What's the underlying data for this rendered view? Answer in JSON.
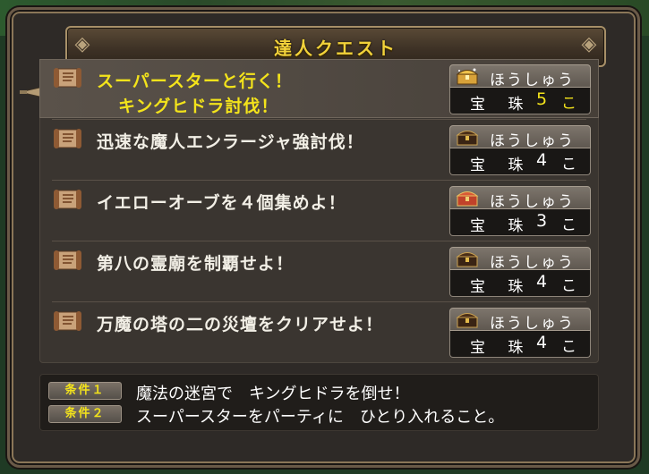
{
  "window": {
    "title": "達人クエスト"
  },
  "quests": [
    {
      "line1": "スーパースターと行く！",
      "line2": "キングヒドラ討伐！",
      "reward_label": "ほうしゅう",
      "gem_label": "宝 珠",
      "count": "5",
      "unit": "こ",
      "selected": true,
      "chest": "gold"
    },
    {
      "line1": "迅速な魔人エンラージャ強討伐！",
      "line2": "",
      "reward_label": "ほうしゅう",
      "gem_label": "宝 珠",
      "count": "4",
      "unit": "こ",
      "selected": false,
      "chest": "dark"
    },
    {
      "line1": "イエローオーブを４個集めよ！",
      "line2": "",
      "reward_label": "ほうしゅう",
      "gem_label": "宝 珠",
      "count": "3",
      "unit": "こ",
      "selected": false,
      "chest": "red"
    },
    {
      "line1": "第八の霊廟を制覇せよ！",
      "line2": "",
      "reward_label": "ほうしゅう",
      "gem_label": "宝 珠",
      "count": "4",
      "unit": "こ",
      "selected": false,
      "chest": "dark"
    },
    {
      "line1": "万魔の塔の二の災壇をクリアせよ！",
      "line2": "",
      "reward_label": "ほうしゅう",
      "gem_label": "宝 珠",
      "count": "4",
      "unit": "こ",
      "selected": false,
      "chest": "dark"
    }
  ],
  "conditions": [
    {
      "badge": "条件１",
      "text": "魔法の迷宮で　キングヒドラを倒せ！"
    },
    {
      "badge": "条件２",
      "text": "スーパースターをパーティに　ひとり入れること。"
    }
  ],
  "colors": {
    "highlight": "#f3e31b",
    "text": "#f2efe6",
    "panel": "#2e2a27"
  },
  "icons": {
    "row": "quest-scroll-icon",
    "cursor": "selection-cursor-icon",
    "reward": "treasure-chest-icon"
  }
}
